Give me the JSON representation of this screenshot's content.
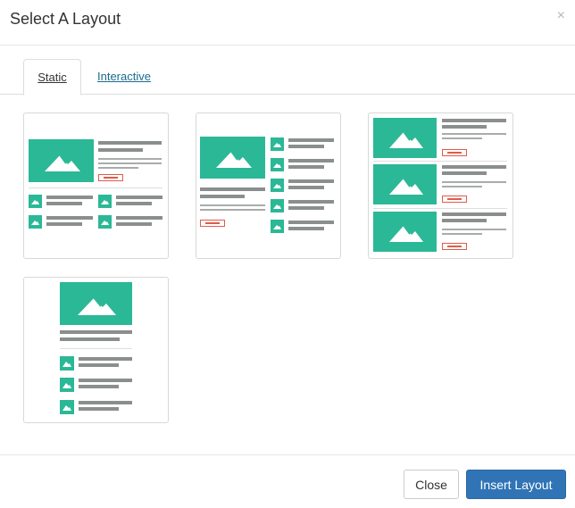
{
  "dialog": {
    "title": "Select A Layout",
    "close_symbol": "×"
  },
  "tabs": [
    {
      "label": "Static",
      "active": true
    },
    {
      "label": "Interactive",
      "active": false
    }
  ],
  "layouts": [
    {
      "name": "layout-featured-grid"
    },
    {
      "name": "layout-featured-list"
    },
    {
      "name": "layout-stacked-rows"
    },
    {
      "name": "layout-single-column"
    }
  ],
  "footer": {
    "close_label": "Close",
    "insert_label": "Insert Layout"
  },
  "colors": {
    "accent_green": "#2bb896",
    "primary_blue": "#3174b6",
    "link_blue": "#1a6c8f",
    "cta_red": "#e05c4a"
  },
  "icons": {
    "image_placeholder": "mountain-image-icon"
  }
}
